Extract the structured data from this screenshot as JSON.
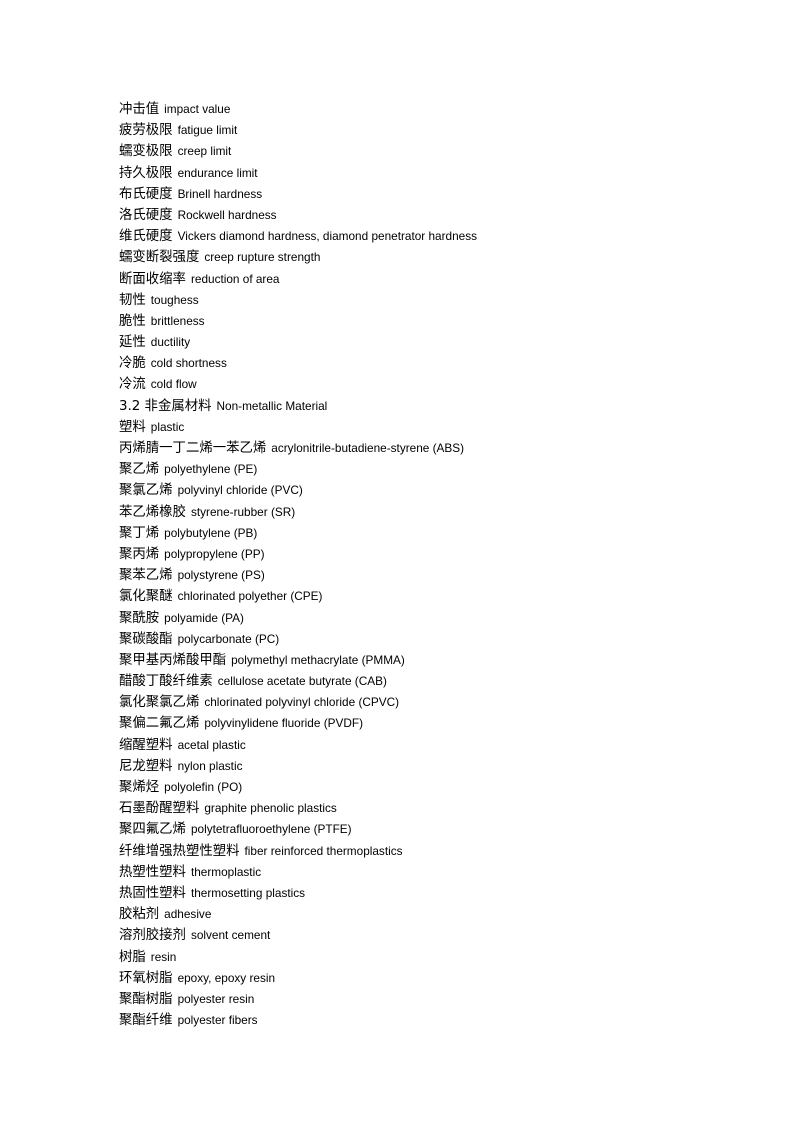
{
  "document": {
    "type": "bilingual-glossary",
    "language_pair": "Chinese-English",
    "background_color": "#ffffff",
    "text_color": "#000000",
    "line_count": 43
  },
  "entries": [
    {
      "term": "冲击值",
      "gloss": "impact value",
      "heading": false
    },
    {
      "term": "疲劳极限",
      "gloss": "fatigue limit",
      "heading": false
    },
    {
      "term": "蠕变极限",
      "gloss": "creep limit",
      "heading": false
    },
    {
      "term": "持久极限",
      "gloss": "endurance limit",
      "heading": false
    },
    {
      "term": "布氏硬度",
      "gloss": "Brinell hardness",
      "heading": false
    },
    {
      "term": "洛氏硬度",
      "gloss": "Rockwell hardness",
      "heading": false
    },
    {
      "term": "维氏硬度",
      "gloss": "Vickers diamond hardness, diamond penetrator hardness",
      "heading": false
    },
    {
      "term": "蠕变断裂强度",
      "gloss": "creep rupture strength",
      "heading": false
    },
    {
      "term": "断面收缩率",
      "gloss": "reduction of area",
      "heading": false
    },
    {
      "term": "韧性",
      "gloss": "toughess",
      "heading": false
    },
    {
      "term": "脆性",
      "gloss": "brittleness",
      "heading": false
    },
    {
      "term": "延性",
      "gloss": "ductility",
      "heading": false
    },
    {
      "term": "冷脆",
      "gloss": "cold shortness",
      "heading": false
    },
    {
      "term": "冷流",
      "gloss": "cold flow",
      "heading": false
    },
    {
      "term": "3.2 非金属材料",
      "gloss": "Non-metallic Material",
      "heading": true
    },
    {
      "term": "塑料",
      "gloss": "plastic",
      "heading": false
    },
    {
      "term": "丙烯腈一丁二烯一苯乙烯",
      "gloss": "acrylonitrile-butadiene-styrene (ABS)",
      "heading": false
    },
    {
      "term": "聚乙烯",
      "gloss": "polyethylene (PE)",
      "heading": false
    },
    {
      "term": "聚氯乙烯",
      "gloss": "polyvinyl chloride (PVC)",
      "heading": false
    },
    {
      "term": "苯乙烯橡胶",
      "gloss": "styrene-rubber (SR)",
      "heading": false
    },
    {
      "term": "聚丁烯",
      "gloss": "polybutylene (PB)",
      "heading": false
    },
    {
      "term": "聚丙烯",
      "gloss": "polypropylene (PP)",
      "heading": false
    },
    {
      "term": "聚苯乙烯",
      "gloss": "polystyrene (PS)",
      "heading": false
    },
    {
      "term": "氯化聚醚",
      "gloss": "chlorinated polyether (CPE)",
      "heading": false
    },
    {
      "term": "聚酰胺",
      "gloss": "polyamide (PA)",
      "heading": false
    },
    {
      "term": "聚碳酸酯",
      "gloss": "polycarbonate (PC)",
      "heading": false
    },
    {
      "term": "聚甲基丙烯酸甲酯",
      "gloss": "polymethyl methacrylate (PMMA)",
      "heading": false
    },
    {
      "term": "醋酸丁酸纤维素",
      "gloss": "cellulose acetate butyrate (CAB)",
      "heading": false
    },
    {
      "term": "氯化聚氯乙烯",
      "gloss": "chlorinated polyvinyl chloride (CPVC)",
      "heading": false
    },
    {
      "term": "聚偏二氟乙烯",
      "gloss": "polyvinylidene fluoride (PVDF)",
      "heading": false
    },
    {
      "term": "缩醒塑料",
      "gloss": "acetal plastic",
      "heading": false
    },
    {
      "term": "尼龙塑料",
      "gloss": "nylon plastic",
      "heading": false
    },
    {
      "term": "聚烯烃",
      "gloss": "polyolefin (PO)",
      "heading": false
    },
    {
      "term": "石墨酚醒塑料",
      "gloss": "graphite phenolic plastics",
      "heading": false
    },
    {
      "term": "聚四氟乙烯",
      "gloss": "polytetrafluoroethylene (PTFE)",
      "heading": false
    },
    {
      "term": "纤维增强热塑性塑料",
      "gloss": "fiber reinforced thermoplastics",
      "heading": false
    },
    {
      "term": "热塑性塑料",
      "gloss": "thermoplastic",
      "heading": false
    },
    {
      "term": "热固性塑料",
      "gloss": "thermosetting plastics",
      "heading": false
    },
    {
      "term": "胶粘剂",
      "gloss": "adhesive",
      "heading": false
    },
    {
      "term": "溶剂胶接剂",
      "gloss": "solvent cement",
      "heading": false
    },
    {
      "term": "树脂",
      "gloss": "resin",
      "heading": false
    },
    {
      "term": "环氧树脂",
      "gloss": "epoxy, epoxy resin",
      "heading": false
    },
    {
      "term": "聚酯树脂",
      "gloss": "polyester resin",
      "heading": false
    },
    {
      "term": "聚酯纤维",
      "gloss": "polyester fibers",
      "heading": false
    }
  ]
}
